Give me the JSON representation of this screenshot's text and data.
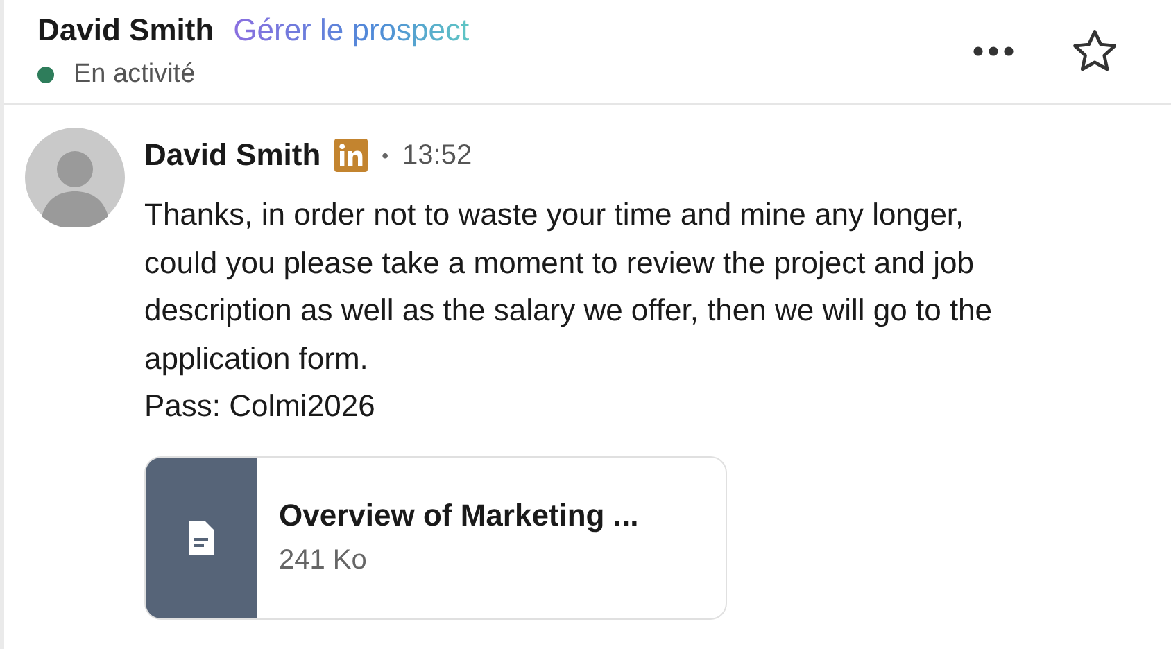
{
  "header": {
    "name": "David Smith",
    "action_link": "Gérer le prospect",
    "status": {
      "online": true,
      "label": "En activité"
    }
  },
  "message": {
    "sender": "David Smith",
    "linkedin": true,
    "separator": "•",
    "time": "13:52",
    "body": "Thanks, in order not to waste your time and mine any longer, could you please take a moment to review the project and job description as well as the salary we offer, then we will go to the application form.",
    "pass_line": "Pass: Colmi2026",
    "attachment": {
      "name": "Overview of Marketing ...",
      "size": "241 Ko"
    }
  }
}
